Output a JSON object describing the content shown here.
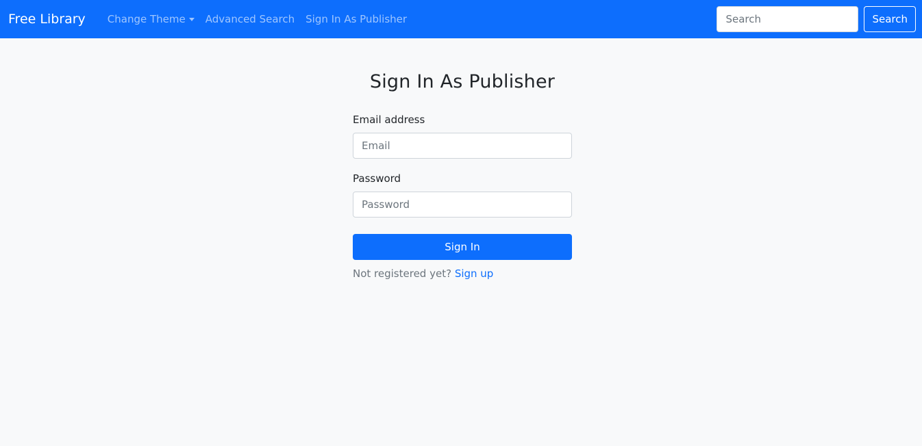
{
  "navbar": {
    "brand": "Free Library",
    "links": {
      "change_theme": "Change Theme",
      "advanced_search": "Advanced Search",
      "sign_in_publisher": "Sign In As Publisher"
    },
    "search": {
      "placeholder": "Search",
      "value": "",
      "button_label": "Search"
    }
  },
  "form": {
    "title": "Sign In As Publisher",
    "email": {
      "label": "Email address",
      "placeholder": "Email",
      "value": ""
    },
    "password": {
      "label": "Password",
      "placeholder": "Password",
      "value": ""
    },
    "submit_label": "Sign In",
    "register_prompt": "Not registered yet?",
    "register_link": "Sign up"
  },
  "colors": {
    "primary": "#0d6efd",
    "background": "#f8f9fa",
    "text": "#212529",
    "muted": "#6c757d"
  }
}
